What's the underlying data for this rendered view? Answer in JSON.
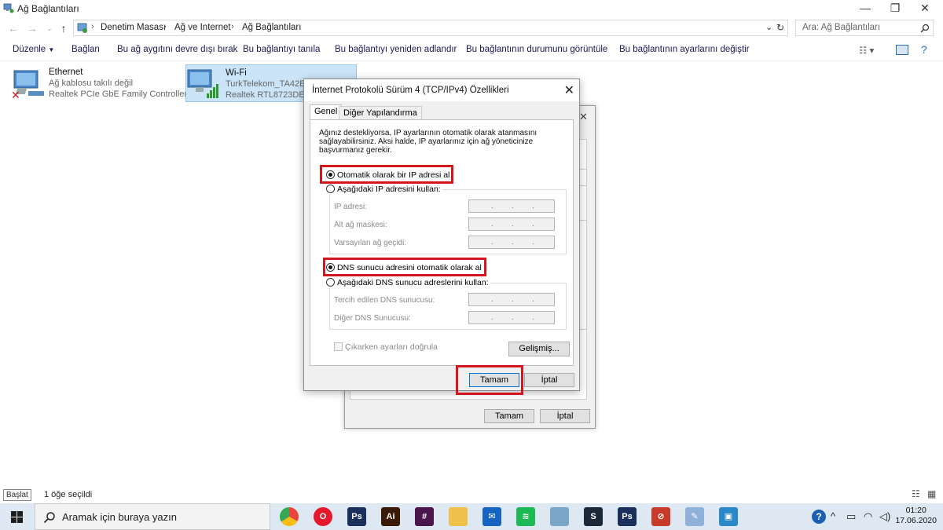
{
  "window": {
    "title": "Ağ Bağlantıları",
    "btn_min": "—",
    "btn_max": "❐",
    "btn_close": "✕"
  },
  "address": {
    "crumbs": [
      "Denetim Masası",
      "Ağ ve Internet",
      "Ağ Bağlantıları"
    ],
    "separator": "›",
    "search_placeholder": "Ara: Ağ Bağlantıları"
  },
  "commands": {
    "organize": "Düzenle",
    "connect": "Bağlan",
    "disable": "Bu ağ aygıtını devre dışı bırak",
    "diagnose": "Bu bağlantıyı tanıla",
    "rename": "Bu bağlantıyı yeniden adlandır",
    "status": "Bu bağlantının durumunu görüntüle",
    "settings": "Bu bağlantının ayarlarını değiştir"
  },
  "connections": [
    {
      "name": "Ethernet",
      "status": "Ağ kablosu takılı değil",
      "device": "Realtek PCIe GbE Family Controller"
    },
    {
      "name": "Wi-Fi",
      "status": "TurkTelekom_TA42E",
      "device": "Realtek RTL8723DE 802"
    }
  ],
  "bg_dialog": {
    "ok": "Tamam",
    "cancel": "İptal"
  },
  "dialog": {
    "title": "İnternet Protokolü Sürüm 4 (TCP/IPv4) Özellikleri",
    "close": "✕",
    "tabs": [
      "Genel",
      "Diğer Yapılandırma"
    ],
    "description": "Ağınız destekliyorsa, IP ayarlarının otomatik olarak atanmasını sağlayabilirsiniz. Aksi halde, IP ayarlarınız için ağ yöneticinize başvurmanız gerekir.",
    "auto_ip": "Otomatik olarak bir IP adresi al",
    "manual_ip": "Aşağıdaki IP adresini kullan:",
    "ip_label": "IP adresi:",
    "mask_label": "Alt ağ maskesi:",
    "gateway_label": "Varsayılan ağ geçidi:",
    "auto_dns": "DNS sunucu adresini otomatik olarak al",
    "manual_dns": "Aşağıdaki DNS sunucu adreslerini kullan:",
    "preferred_dns_label": "Tercih edilen DNS sunucusu:",
    "alternate_dns_label": "Diğer DNS Sunucusu:",
    "validate": "Çıkarken ayarları doğrula",
    "advanced": "Gelişmiş...",
    "ok": "Tamam",
    "cancel": "İptal",
    "ip_dot": "."
  },
  "statusbar": {
    "selected": "1 öğe seçildi",
    "tooltip": "Başlat"
  },
  "taskbar": {
    "search_placeholder": "Aramak için buraya yazın",
    "time": "01:20",
    "date": "17.06.2020",
    "apps": [
      {
        "name": "chrome",
        "label": "",
        "color": "#e8453c"
      },
      {
        "name": "opera",
        "label": "O",
        "color": "#e4172b"
      },
      {
        "name": "photoshop",
        "label": "Ps",
        "color": "#1b2f5c"
      },
      {
        "name": "illustrator",
        "label": "Ai",
        "color": "#3a1a04"
      },
      {
        "name": "slack",
        "label": "#",
        "color": "#4a154b"
      },
      {
        "name": "file-explorer",
        "label": "",
        "color": "#f0c14a"
      },
      {
        "name": "mail",
        "label": "✉",
        "color": "#1565c0"
      },
      {
        "name": "spotify",
        "label": "≋",
        "color": "#1db954"
      },
      {
        "name": "app-9",
        "label": "",
        "color": "#7aa6c8"
      },
      {
        "name": "steam",
        "label": "S",
        "color": "#1b2838"
      },
      {
        "name": "photoshop-2",
        "label": "Ps",
        "color": "#1b2f5c"
      },
      {
        "name": "app-12",
        "label": "⊘",
        "color": "#c83b2a"
      },
      {
        "name": "app-13",
        "label": "✎",
        "color": "#8fb0d8"
      },
      {
        "name": "control-panel",
        "label": "▣",
        "color": "#2a88c8"
      }
    ]
  }
}
